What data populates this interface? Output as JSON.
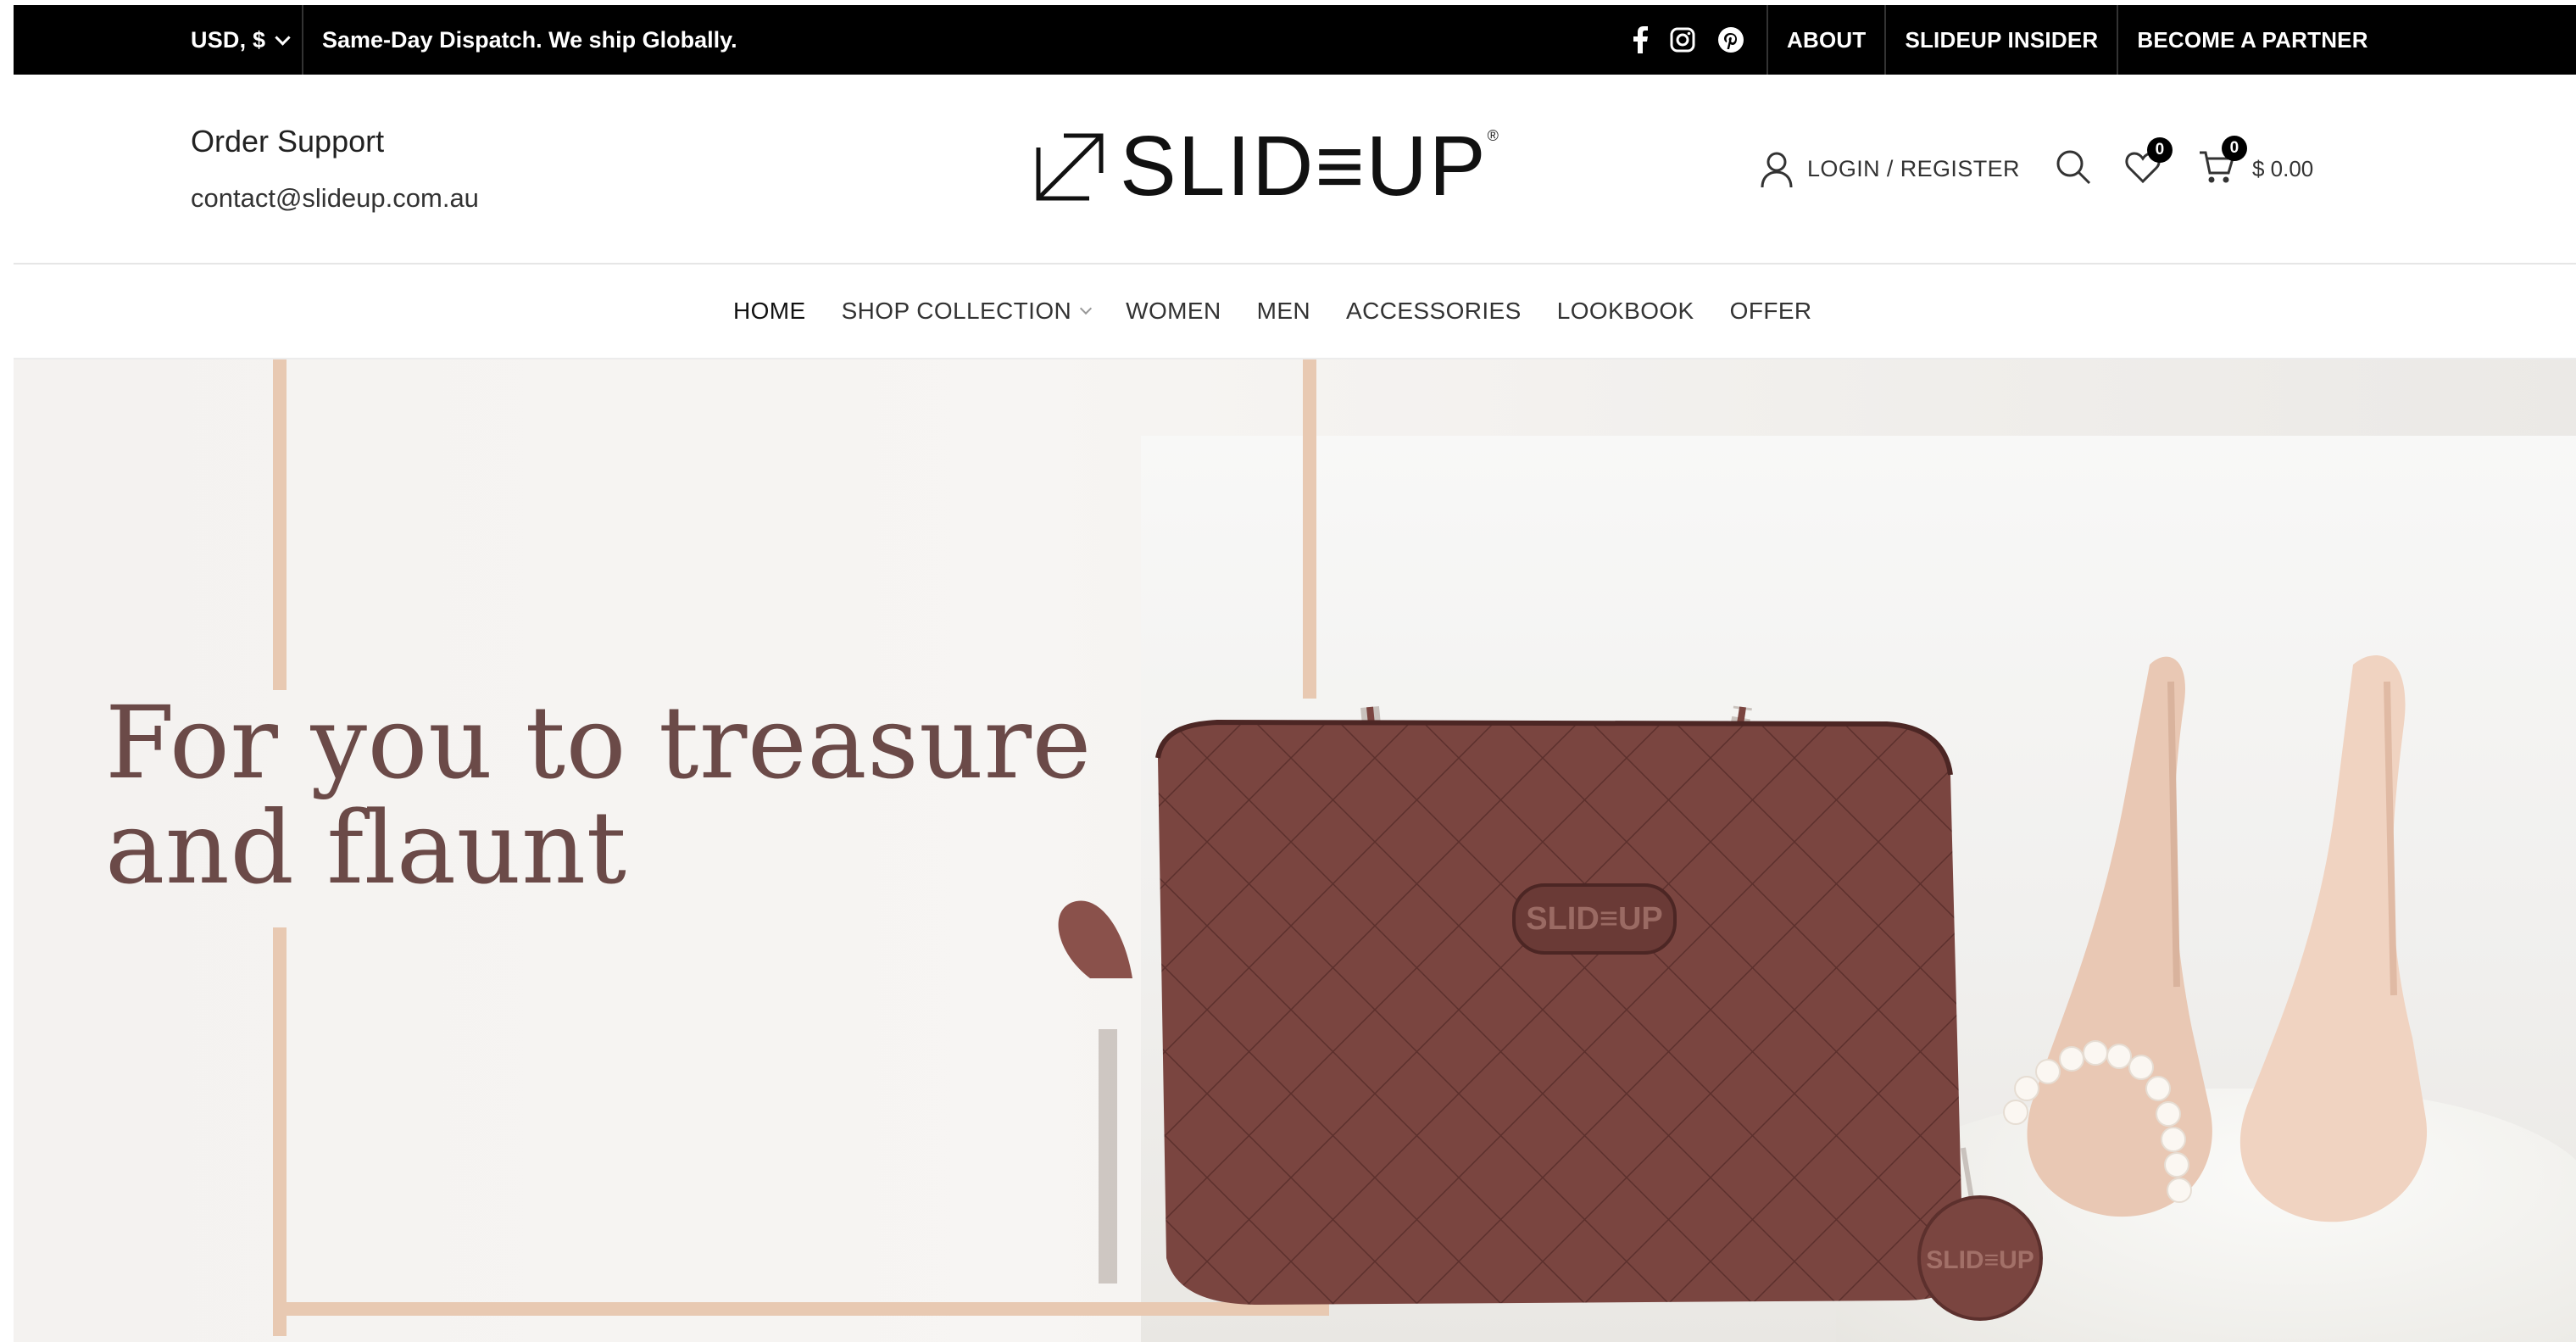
{
  "topbar": {
    "currency": "USD, $",
    "promo": "Same-Day Dispatch. We ship Globally.",
    "social_icons": [
      "facebook-icon",
      "instagram-icon",
      "pinterest-icon"
    ],
    "links": [
      "ABOUT",
      "SLIDEUP INSIDER",
      "BECOME A PARTNER"
    ]
  },
  "header": {
    "order_support_title": "Order Support",
    "order_support_email": "contact@slideup.com.au",
    "logo_text": "SLID≡UP",
    "logo_reg": "®",
    "login_label": "LOGIN / REGISTER",
    "wishlist_count": "0",
    "cart_count": "0",
    "cart_total": "$ 0.00"
  },
  "nav": {
    "items": [
      {
        "label": "HOME",
        "active": true
      },
      {
        "label": "SHOP COLLECTION",
        "has_dropdown": true
      },
      {
        "label": "WOMEN"
      },
      {
        "label": "MEN"
      },
      {
        "label": "ACCESSORIES"
      },
      {
        "label": "LOOKBOOK"
      },
      {
        "label": "OFFER"
      }
    ]
  },
  "hero": {
    "headline_line1": "For you to treasure",
    "headline_line2": "and flaunt",
    "bag_tag_text": "SLID≡UP",
    "colors": {
      "headline": "#6b4a48",
      "frame": "#e8c9b2",
      "bag": "#7a4540",
      "heels": "#e9c8b4"
    }
  }
}
